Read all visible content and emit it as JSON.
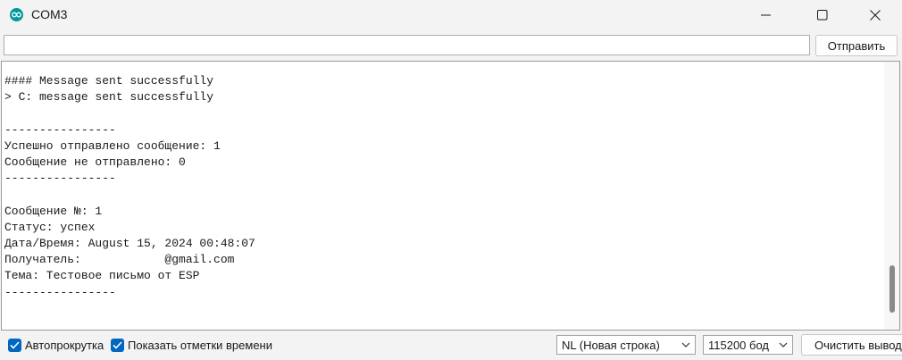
{
  "window": {
    "title": "COM3"
  },
  "send": {
    "input_value": "",
    "button_label": "Отправить"
  },
  "output": {
    "lines": [
      "#### Message sent successfully",
      "> C: message sent successfully",
      "",
      "----------------",
      "Успешно отправлено сообщение: 1",
      "Сообщение не отправлено: 0",
      "----------------",
      "",
      "Сообщение №: 1",
      "Статус: успех",
      "Дата/Время: August 15, 2024 00:48:07",
      "Получатель:            @gmail.com",
      "Тема: Тестовое письмо от ESP",
      "----------------"
    ]
  },
  "bottom": {
    "autoscroll_label": "Автопрокрутка",
    "autoscroll_checked": true,
    "timestamps_label": "Показать отметки времени",
    "timestamps_checked": true,
    "line_ending_value": "NL (Новая строка)",
    "baud_value": "115200 бод",
    "clear_label": "Очистить вывод"
  },
  "colors": {
    "accent": "#0067c0",
    "app_icon": "#00979d"
  },
  "icons": {
    "app": "arduino-logo-icon",
    "minimize": "minimize-icon",
    "maximize": "maximize-icon",
    "close": "close-icon",
    "dropdown": "chevron-down-icon",
    "check": "checkmark-icon"
  }
}
